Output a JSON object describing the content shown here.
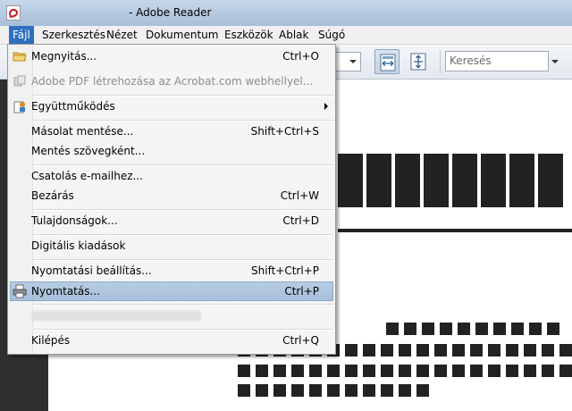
{
  "window": {
    "title": " - Adobe Reader",
    "icon": "adobe-pdf-icon"
  },
  "menubar": {
    "items": [
      "Fájl",
      "Szerkesztés",
      "Nézet",
      "Dokumentum",
      "Eszközök",
      "Ablak",
      "Súgó"
    ]
  },
  "toolbar": {
    "search_placeholder": "Keresés",
    "buttons": [
      {
        "name": "fit-width-icon",
        "pressed": true
      },
      {
        "name": "fit-page-icon",
        "pressed": false
      }
    ]
  },
  "file_menu": {
    "items": [
      {
        "label": "Megnyitás...",
        "shortcut": "Ctrl+O",
        "icon": "folder-icon",
        "enabled": true
      },
      {
        "label": "Adobe PDF létrehozása az Acrobat.com webhellyel...",
        "shortcut": "",
        "icon": "acrobat-com-icon",
        "enabled": false
      },
      {
        "label": "Együttműködés",
        "shortcut": "",
        "icon": "collaboration-icon",
        "enabled": true,
        "submenu": true
      },
      {
        "label": "Másolat mentése...",
        "shortcut": "Shift+Ctrl+S",
        "enabled": true
      },
      {
        "label": "Mentés szövegként...",
        "shortcut": "",
        "enabled": true
      },
      {
        "label": "Csatolás e-mailhez...",
        "shortcut": "",
        "enabled": true
      },
      {
        "label": "Bezárás",
        "shortcut": "Ctrl+W",
        "enabled": true
      },
      {
        "label": "Tulajdonságok...",
        "shortcut": "Ctrl+D",
        "enabled": true
      },
      {
        "label": "Digitális kiadások",
        "shortcut": "",
        "enabled": true
      },
      {
        "label": "Nyomtatási beállítás...",
        "shortcut": "Shift+Ctrl+P",
        "enabled": true
      },
      {
        "label": "Nyomtatás...",
        "shortcut": "Ctrl+P",
        "icon": "printer-icon",
        "enabled": true,
        "highlighted": true
      },
      {
        "label": "Kilépés",
        "shortcut": "Ctrl+Q",
        "enabled": true
      }
    ]
  },
  "colors": {
    "menu_highlight": "#a8c0da",
    "menubar_active": "#2f6fbf",
    "document_bg": "#ffffff",
    "nav_bg": "#2f2f2f"
  }
}
